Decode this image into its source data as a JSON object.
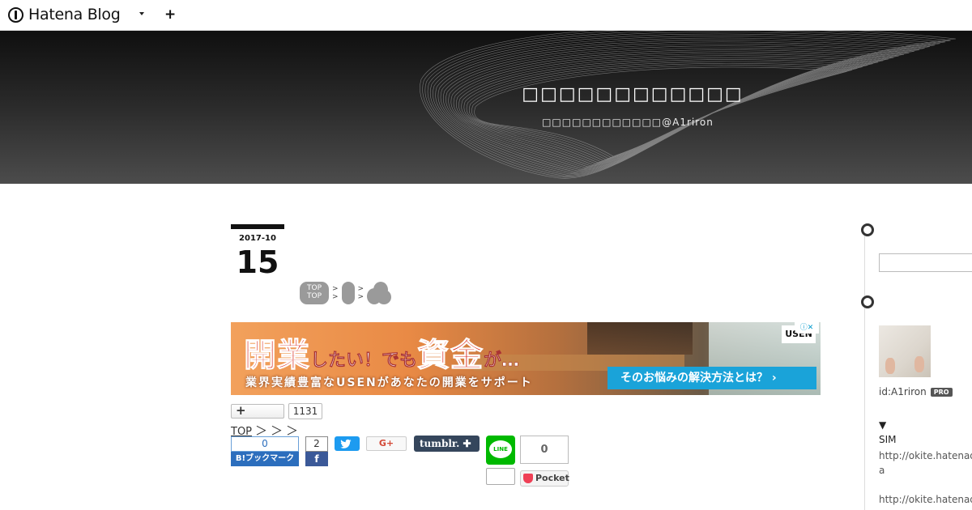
{
  "globalbar": {
    "logo_text": "Hatena Blog",
    "plus_label": "+"
  },
  "header": {
    "blog_title": "□□□□□□□□□□□□",
    "blog_description": "□□□□□□□□□□□□@A1riron"
  },
  "entry": {
    "date_year_month": "2017-10",
    "date_day": "15",
    "breadcrumb": {
      "top_upper": "TOP",
      "top_lower": "TOP",
      "sep_upper": ">",
      "sep_lower": ">"
    }
  },
  "ad": {
    "headline_1": "開業",
    "headline_2": "したい！でも",
    "headline_3": "資金",
    "headline_4": "が…",
    "subline": "業界実績豊富なUSENがあなたの開業をサポート",
    "cta": "そのお悩みの解決方法とは？ ›",
    "brand": "USEN",
    "ad_choice": "ⓘ✕"
  },
  "stars": {
    "add_label": "+",
    "count": "1131"
  },
  "nav": {
    "top_link": "TOP",
    "arrows": [
      "＞",
      "＞",
      "＞"
    ]
  },
  "share": {
    "hatena_count": "0",
    "hatena_label": "B!ブックマーク",
    "facebook_count": "2",
    "facebook_label": "f",
    "google_label": "G+",
    "tumblr_label": "tumblr. ✚",
    "line_label": "LINE",
    "pocket_count": "0",
    "pocket_label": "Pocket"
  },
  "sidebar": {
    "user_id": "id:A1riron",
    "pro_badge": "PRO",
    "section_toggle": "▼",
    "section_title": "SIM",
    "links": [
      "http://okite.hatenad",
      "a",
      "",
      "http://okite.hatenad"
    ]
  },
  "colors": {
    "hatena_blue": "#2c6ebd",
    "facebook": "#3b5998",
    "twitter": "#1d9bf0",
    "tumblr": "#35465c",
    "line": "#00b900",
    "pocket": "#ef4056",
    "ad_cta": "#1aa3d9"
  }
}
